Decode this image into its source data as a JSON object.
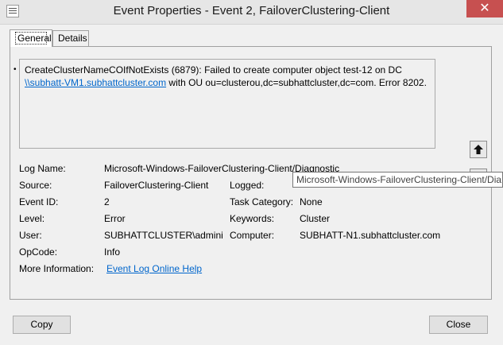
{
  "window": {
    "title": "Event Properties - Event 2, FailoverClustering-Client",
    "close_glyph": "✕"
  },
  "tabs": [
    {
      "label": "General"
    },
    {
      "label": "Details"
    }
  ],
  "description": {
    "line1": "CreateClusterNameCOIfNotExists (6879): Failed to create computer object test-12 on DC",
    "link": "\\\\subhatt-VM1.subhattcluster.com",
    "line2_rest": " with OU ou=clusterou,dc=subhattcluster,dc=com. Error 8202."
  },
  "fields": {
    "log_name": {
      "label": "Log Name:",
      "value": "Microsoft-Windows-FailoverClustering-Client/Diagnostic"
    },
    "source": {
      "label": "Source:",
      "value": "FailoverClustering-Client"
    },
    "logged": {
      "label": "Logged:",
      "value": ""
    },
    "event_id": {
      "label": "Event ID:",
      "value": "2"
    },
    "task_category": {
      "label": "Task Category:",
      "value": "None"
    },
    "level": {
      "label": "Level:",
      "value": "Error"
    },
    "keywords": {
      "label": "Keywords:",
      "value": "Cluster"
    },
    "user": {
      "label": "User:",
      "value": "SUBHATTCLUSTER\\administ"
    },
    "computer": {
      "label": "Computer:",
      "value": "SUBHATT-N1.subhattcluster.com"
    },
    "opcode": {
      "label": "OpCode:",
      "value": "Info"
    },
    "more_info": {
      "label": "More Information:",
      "link": "Event Log Online Help"
    }
  },
  "tooltip": {
    "text": "Microsoft-Windows-FailoverClustering-Client/Dia"
  },
  "buttons": {
    "copy": "Copy",
    "close": "Close"
  }
}
